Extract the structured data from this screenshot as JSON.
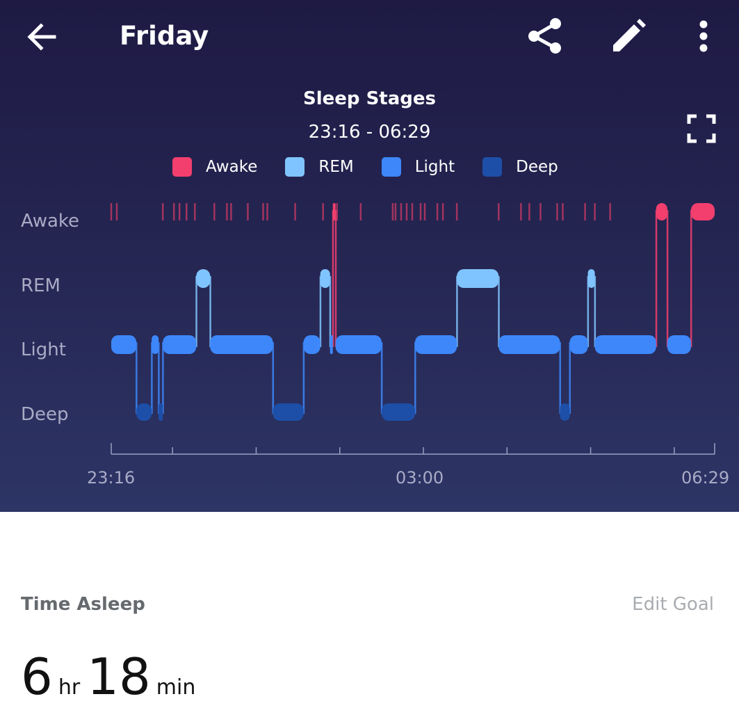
{
  "header": {
    "title": "Friday",
    "back_icon": "arrow-left-icon",
    "share_icon": "share-icon",
    "edit_icon": "pencil-icon",
    "more_icon": "more-vertical-icon"
  },
  "chart_data": {
    "type": "area",
    "title": "Sleep Stages",
    "subtitle": "23:16 - 06:29",
    "expand_icon": "fullscreen-icon",
    "legend": [
      {
        "name": "Awake",
        "color": "#f23f6e"
      },
      {
        "name": "REM",
        "color": "#80c4ff"
      },
      {
        "name": "Light",
        "color": "#3d87fa"
      },
      {
        "name": "Deep",
        "color": "#1d4fa8"
      }
    ],
    "y_categories": [
      "Awake",
      "REM",
      "Light",
      "Deep"
    ],
    "x_ticks": [
      "23:16",
      "03:00",
      "06:29"
    ],
    "x_range": [
      "23:16",
      "06:29"
    ],
    "segments": [
      {
        "stage": "Light",
        "start": "23:16",
        "end": "23:34"
      },
      {
        "stage": "Deep",
        "start": "23:34",
        "end": "23:45"
      },
      {
        "stage": "Light",
        "start": "23:45",
        "end": "23:50"
      },
      {
        "stage": "Deep",
        "start": "23:50",
        "end": "23:53"
      },
      {
        "stage": "Light",
        "start": "23:53",
        "end": "00:17"
      },
      {
        "stage": "REM",
        "start": "00:17",
        "end": "00:27"
      },
      {
        "stage": "Light",
        "start": "00:27",
        "end": "01:12"
      },
      {
        "stage": "Deep",
        "start": "01:12",
        "end": "01:34"
      },
      {
        "stage": "Light",
        "start": "01:34",
        "end": "01:46"
      },
      {
        "stage": "REM",
        "start": "01:46",
        "end": "01:53"
      },
      {
        "stage": "Light",
        "start": "01:53",
        "end": "01:55"
      },
      {
        "stage": "Awake",
        "start": "01:55",
        "end": "01:57"
      },
      {
        "stage": "Light",
        "start": "01:57",
        "end": "02:30"
      },
      {
        "stage": "Deep",
        "start": "02:30",
        "end": "02:54"
      },
      {
        "stage": "Light",
        "start": "02:54",
        "end": "03:24"
      },
      {
        "stage": "REM",
        "start": "03:24",
        "end": "03:54"
      },
      {
        "stage": "Light",
        "start": "03:54",
        "end": "04:38"
      },
      {
        "stage": "Deep",
        "start": "04:38",
        "end": "04:45"
      },
      {
        "stage": "Light",
        "start": "04:45",
        "end": "04:58"
      },
      {
        "stage": "REM",
        "start": "04:58",
        "end": "05:03"
      },
      {
        "stage": "Light",
        "start": "05:03",
        "end": "05:47"
      },
      {
        "stage": "Awake",
        "start": "05:47",
        "end": "05:55"
      },
      {
        "stage": "Light",
        "start": "05:55",
        "end": "06:12"
      },
      {
        "stage": "Awake",
        "start": "06:12",
        "end": "06:29"
      }
    ],
    "brief_awakenings": [
      "23:16",
      "23:20",
      "23:53",
      "24:01",
      "24:05",
      "24:10",
      "24:16",
      "24:30",
      "24:39",
      "24:42",
      "24:54",
      "25:05",
      "25:08",
      "25:28",
      "25:48",
      "25:58",
      "26:15",
      "26:38",
      "26:40",
      "26:44",
      "26:48",
      "26:52",
      "26:58",
      "27:01",
      "27:10",
      "27:14",
      "27:24",
      "27:54",
      "28:10",
      "28:16",
      "28:24",
      "28:36",
      "28:40",
      "28:56",
      "29:03",
      "29:14"
    ]
  },
  "summary": {
    "section_label": "Time Asleep",
    "edit_goal": "Edit Goal",
    "hours": "6",
    "hours_unit": "hr",
    "minutes": "18",
    "minutes_unit": "min"
  }
}
